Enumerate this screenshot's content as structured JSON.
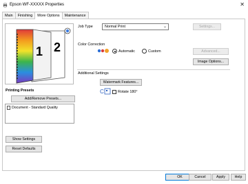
{
  "window": {
    "title": "Epson WF-XXXXX Properties",
    "close_glyph": "✕"
  },
  "tabs": [
    {
      "label": "Main"
    },
    {
      "label": "Finishing"
    },
    {
      "label": "More Options"
    },
    {
      "label": "Maintenance"
    }
  ],
  "preview": {
    "page1_number": "1",
    "page2_number": "2"
  },
  "job_type": {
    "label": "Job Type",
    "selected": "Normal Print",
    "settings_button": "Settings..."
  },
  "color_correction": {
    "label": "Color Correction",
    "options": [
      {
        "label": "Automatic",
        "checked": true
      },
      {
        "label": "Custom",
        "checked": false
      }
    ],
    "advanced_button": "Advanced...",
    "image_options_button": "Image Options..."
  },
  "additional_settings": {
    "label": "Additional Settings",
    "watermark_button": "Watermark Features...",
    "rotate_label": "Rotate 180°",
    "rotate_checked": false
  },
  "printing_presets": {
    "label": "Printing Presets",
    "add_remove_button": "Add/Remove Presets...",
    "items": [
      "Document - Standard Quality"
    ]
  },
  "footer": {
    "show_settings": "Show Settings",
    "reset_defaults": "Reset Defaults",
    "ok": "OK",
    "cancel": "Cancel",
    "apply": "Apply",
    "help": "Help"
  }
}
